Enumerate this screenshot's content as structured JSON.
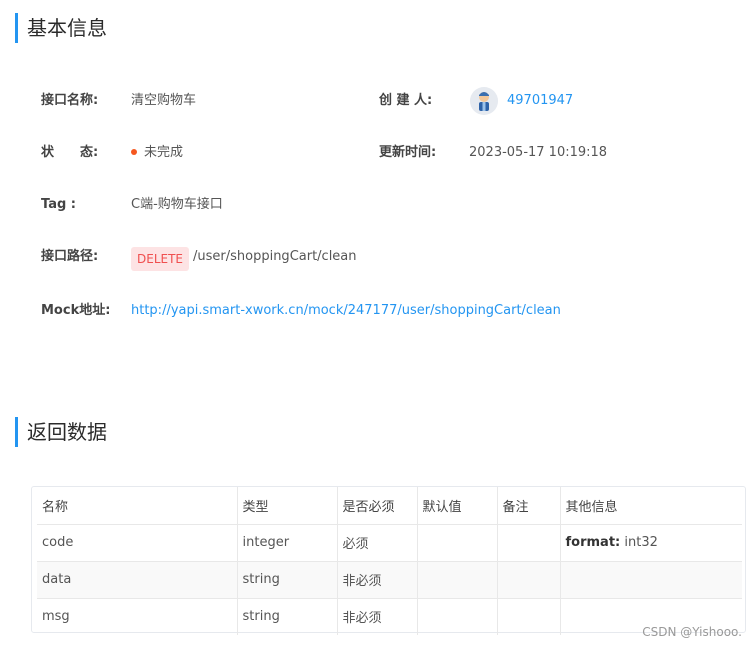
{
  "basic_info": {
    "section_title": "基本信息",
    "name_label": "接口名称:",
    "name_value": "清空购物车",
    "creator_label": "创 建 人:",
    "creator_value": "49701947",
    "status_label": "状　　态:",
    "status_value": "未完成",
    "updated_label": "更新时间:",
    "updated_value": "2023-05-17 10:19:18",
    "tag_label": "Tag :",
    "tag_value": "C端-购物车接口",
    "path_label": "接口路径:",
    "method": "DELETE",
    "path_value": "/user/shoppingCart/clean",
    "mock_label": "Mock地址:",
    "mock_url": "http://yapi.smart-xwork.cn/mock/247177/user/shoppingCart/clean"
  },
  "return_data": {
    "section_title": "返回数据",
    "headers": [
      "名称",
      "类型",
      "是否必须",
      "默认值",
      "备注",
      "其他信息"
    ],
    "rows": [
      {
        "name": "code",
        "type": "integer",
        "required": "必须",
        "default": "",
        "remark": "",
        "other_key": "format:",
        "other_value": " int32"
      },
      {
        "name": "data",
        "type": "string",
        "required": "非必须",
        "default": "",
        "remark": "",
        "other_key": "",
        "other_value": ""
      },
      {
        "name": "msg",
        "type": "string",
        "required": "非必须",
        "default": "",
        "remark": "",
        "other_key": "",
        "other_value": ""
      }
    ]
  },
  "watermark": "CSDN @Yishooo."
}
